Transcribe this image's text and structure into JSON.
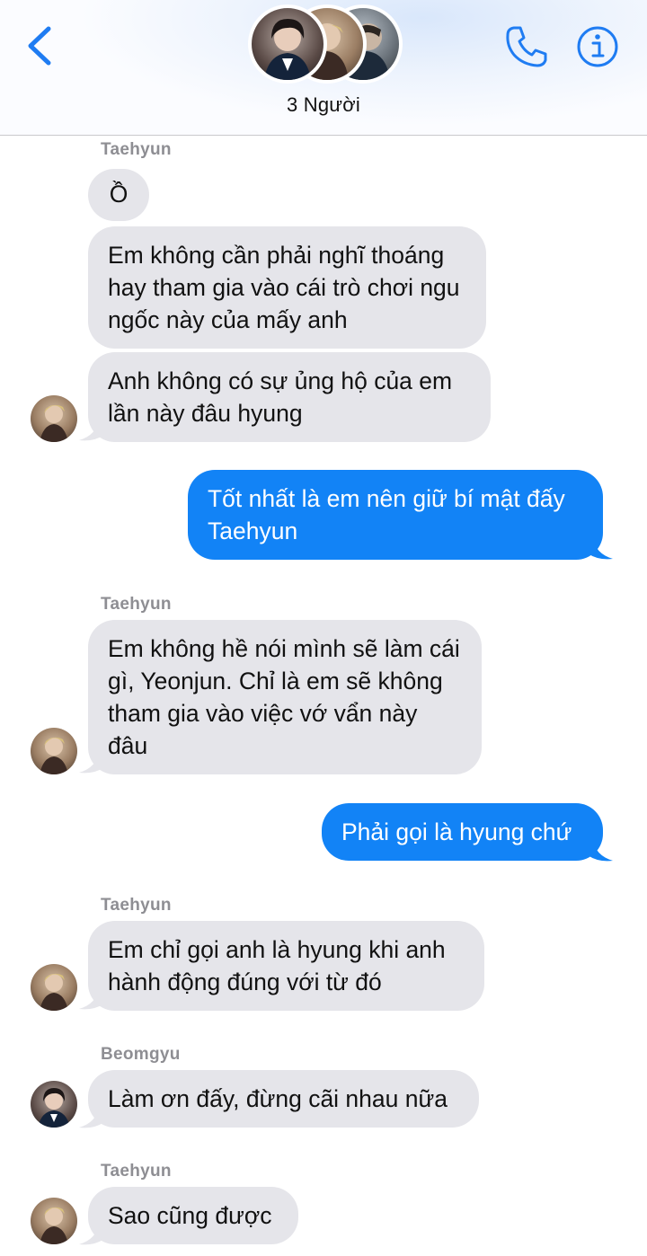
{
  "header": {
    "title": "3 Người",
    "colors": {
      "accent": "#1f7cf2",
      "bubble_out": "#1283f6",
      "bubble_in": "#e5e5ea"
    },
    "icons": [
      "chevron-left-icon",
      "phone-icon",
      "info-icon"
    ]
  },
  "messages": [
    {
      "sender": "Taehyun"
    },
    {
      "text": "Ồ"
    },
    {
      "text": "Em không cần phải nghĩ thoáng hay tham gia vào cái trò chơi ngu ngốc này của mấy anh"
    },
    {
      "text": "Anh không có sự ủng hộ của em lần này đâu hyung"
    },
    {
      "text": "Tốt nhất là em nên giữ bí mật đấy Taehyun"
    },
    {
      "sender": "Taehyun"
    },
    {
      "text": "Em không hề nói mình sẽ làm cái gì, Yeonjun. Chỉ là em sẽ không tham gia vào việc vớ vẩn này đâu"
    },
    {
      "text": "Phải gọi là hyung chứ"
    },
    {
      "sender": "Taehyun"
    },
    {
      "text": "Em chỉ gọi anh là hyung khi anh hành động đúng với từ đó"
    },
    {
      "sender": "Beomgyu"
    },
    {
      "text": "Làm ơn đấy, đừng cãi nhau nữa"
    },
    {
      "sender": "Taehyun"
    },
    {
      "text": "Sao cũng được"
    }
  ]
}
